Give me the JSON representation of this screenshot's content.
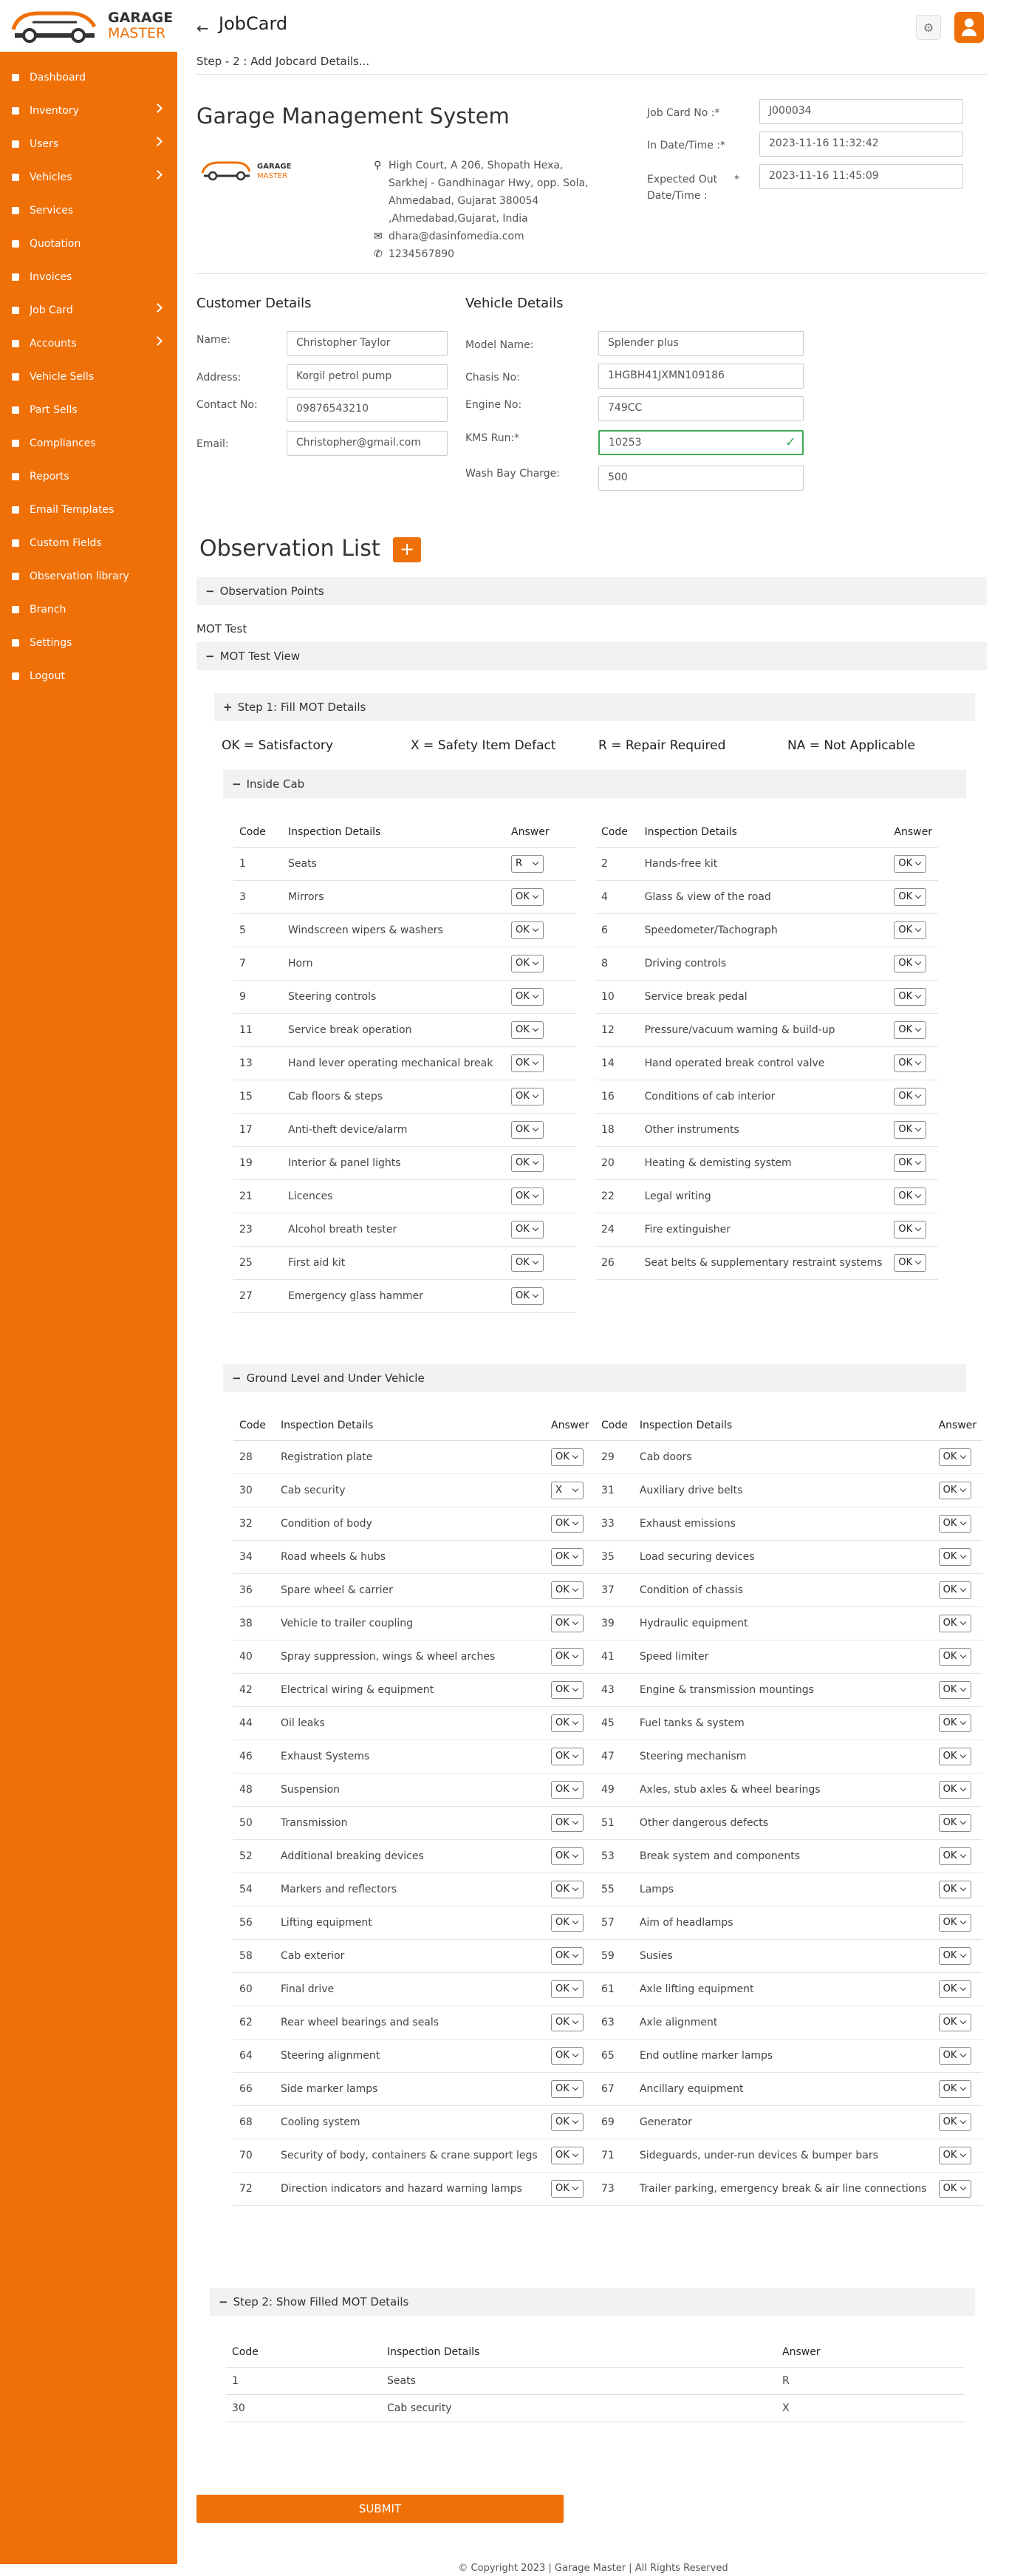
{
  "brand": {
    "line1": "GARAGE",
    "line2": "MASTER"
  },
  "sidebar": {
    "items": [
      {
        "label": "Dashboard",
        "icon": "home-icon",
        "arrow": false
      },
      {
        "label": "Inventory",
        "icon": "inventory-icon",
        "arrow": true
      },
      {
        "label": "Users",
        "icon": "user-icon",
        "arrow": true
      },
      {
        "label": "Vehicles",
        "icon": "car-icon",
        "arrow": true
      },
      {
        "label": "Services",
        "icon": "wrench-icon",
        "arrow": false
      },
      {
        "label": "Quotation",
        "icon": "document-icon",
        "arrow": false
      },
      {
        "label": "Invoices",
        "icon": "invoice-icon",
        "arrow": false
      },
      {
        "label": "Job Card",
        "icon": "jobcard-icon",
        "arrow": true
      },
      {
        "label": "Accounts",
        "icon": "accounts-icon",
        "arrow": true
      },
      {
        "label": "Vehicle Sells",
        "icon": "tag-icon",
        "arrow": false
      },
      {
        "label": "Part Sells",
        "icon": "tag-icon",
        "arrow": false
      },
      {
        "label": "Compliances",
        "icon": "compliance-icon",
        "arrow": false
      },
      {
        "label": "Reports",
        "icon": "reports-icon",
        "arrow": false
      },
      {
        "label": "Email Templates",
        "icon": "email-icon",
        "arrow": false
      },
      {
        "label": "Custom Fields",
        "icon": "puzzle-icon",
        "arrow": false
      },
      {
        "label": "Observation library",
        "icon": "library-icon",
        "arrow": false
      },
      {
        "label": "Branch",
        "icon": "branch-icon",
        "arrow": false
      },
      {
        "label": "Settings",
        "icon": "gear-icon",
        "arrow": false
      },
      {
        "label": "Logout",
        "icon": "power-icon",
        "arrow": false
      }
    ]
  },
  "header": {
    "title": "JobCard",
    "step": "Step - 2 : Add Jobcard Details..."
  },
  "company": {
    "title": "Garage Management System",
    "address": "High Court, A 206, Shopath Hexa, Sarkhej - Gandhinagar Hwy, opp. Sola, Ahmedabad, Gujarat 380054 ,Ahmedabad,Gujarat, India",
    "email": "dhara@dasinfomedia.com",
    "phone": "1234567890"
  },
  "job": {
    "jobcard_label": "Job Card No :*",
    "jobcard_value": "J000034",
    "indate_label": "In Date/Time :*",
    "indate_value": "2023-11-16 11:32:42",
    "outdate_label": "Expected Out Date/Time :",
    "outdate_star": "*",
    "outdate_value": "2023-11-16  11:45:09"
  },
  "customer": {
    "title": "Customer Details",
    "name_label": "Name:",
    "name": "Christopher Taylor",
    "address_label": "Address:",
    "address": "Korgil petrol pump",
    "contact_label": "Contact No:",
    "contact": "09876543210",
    "email_label": "Email:",
    "email": "Christopher@gmail.com"
  },
  "vehicle": {
    "title": "Vehicle Details",
    "model_label": "Model Name:",
    "model": "Splender plus",
    "chassis_label": "Chasis No:",
    "chassis": "1HGBH41JXMN109186",
    "engine_label": "Engine No:",
    "engine": "749CC",
    "kms_label": "KMS Run:*",
    "kms": "10253",
    "wash_label": "Wash Bay Charge:",
    "wash": "500"
  },
  "observation": {
    "title": "Observation List",
    "add": "+",
    "points": "Observation Points",
    "mot_test": "MOT Test",
    "mot_view": "MOT Test View",
    "step1": "Step 1: Fill MOT Details",
    "legend": [
      "OK = Satisfactory",
      "X = Safety Item Defact",
      "R = Repair Required",
      "NA = Not Applicable"
    ],
    "inside_cab": "Inside Cab",
    "ground": "Ground Level and Under Vehicle",
    "step2": "Step 2: Show Filled MOT Details",
    "col_code": "Code",
    "col_details": "Inspection Details",
    "col_answer": "Answer"
  },
  "inside_cab_rows": [
    {
      "code": "1",
      "details": "Seats",
      "answer": "R"
    },
    {
      "code": "2",
      "details": "Hands-free kit",
      "answer": "OK"
    },
    {
      "code": "3",
      "details": "Mirrors",
      "answer": "OK"
    },
    {
      "code": "4",
      "details": "Glass & view of the road",
      "answer": "OK"
    },
    {
      "code": "5",
      "details": "Windscreen wipers & washers",
      "answer": "OK"
    },
    {
      "code": "6",
      "details": "Speedometer/Tachograph",
      "answer": "OK"
    },
    {
      "code": "7",
      "details": "Horn",
      "answer": "OK"
    },
    {
      "code": "8",
      "details": "Driving controls",
      "answer": "OK"
    },
    {
      "code": "9",
      "details": "Steering controls",
      "answer": "OK"
    },
    {
      "code": "10",
      "details": "Service break pedal",
      "answer": "OK"
    },
    {
      "code": "11",
      "details": "Service break operation",
      "answer": "OK"
    },
    {
      "code": "12",
      "details": "Pressure/vacuum warning & build-up",
      "answer": "OK"
    },
    {
      "code": "13",
      "details": "Hand lever operating mechanical break",
      "answer": "OK"
    },
    {
      "code": "14",
      "details": "Hand operated break control valve",
      "answer": "OK"
    },
    {
      "code": "15",
      "details": "Cab floors & steps",
      "answer": "OK"
    },
    {
      "code": "16",
      "details": "Conditions of cab interior",
      "answer": "OK"
    },
    {
      "code": "17",
      "details": "Anti-theft device/alarm",
      "answer": "OK"
    },
    {
      "code": "18",
      "details": "Other instruments",
      "answer": "OK"
    },
    {
      "code": "19",
      "details": "Interior & panel lights",
      "answer": "OK"
    },
    {
      "code": "20",
      "details": "Heating & demisting system",
      "answer": "OK"
    },
    {
      "code": "21",
      "details": "Licences",
      "answer": "OK"
    },
    {
      "code": "22",
      "details": "Legal writing",
      "answer": "OK"
    },
    {
      "code": "23",
      "details": "Alcohol breath tester",
      "answer": "OK"
    },
    {
      "code": "24",
      "details": "Fire extinguisher",
      "answer": "OK"
    },
    {
      "code": "25",
      "details": "First aid kit",
      "answer": "OK"
    },
    {
      "code": "26",
      "details": "Seat belts & supplementary restraint systems",
      "answer": "OK"
    },
    {
      "code": "27",
      "details": "Emergency glass hammer",
      "answer": "OK"
    }
  ],
  "ground_rows": [
    {
      "code": "28",
      "details": "Registration plate",
      "answer": "OK"
    },
    {
      "code": "29",
      "details": "Cab doors",
      "answer": "OK"
    },
    {
      "code": "30",
      "details": "Cab security",
      "answer": "X"
    },
    {
      "code": "31",
      "details": "Auxiliary drive belts",
      "answer": "OK"
    },
    {
      "code": "32",
      "details": "Condition of body",
      "answer": "OK"
    },
    {
      "code": "33",
      "details": "Exhaust emissions",
      "answer": "OK"
    },
    {
      "code": "34",
      "details": "Road wheels & hubs",
      "answer": "OK"
    },
    {
      "code": "35",
      "details": "Load securing devices",
      "answer": "OK"
    },
    {
      "code": "36",
      "details": "Spare wheel & carrier",
      "answer": "OK"
    },
    {
      "code": "37",
      "details": "Condition of chassis",
      "answer": "OK"
    },
    {
      "code": "38",
      "details": "Vehicle to trailer coupling",
      "answer": "OK"
    },
    {
      "code": "39",
      "details": "Hydraulic equipment",
      "answer": "OK"
    },
    {
      "code": "40",
      "details": "Spray suppression, wings & wheel arches",
      "answer": "OK"
    },
    {
      "code": "41",
      "details": "Speed limiter",
      "answer": "OK"
    },
    {
      "code": "42",
      "details": "Electrical wiring & equipment",
      "answer": "OK"
    },
    {
      "code": "43",
      "details": "Engine & transmission mountings",
      "answer": "OK"
    },
    {
      "code": "44",
      "details": "Oil leaks",
      "answer": "OK"
    },
    {
      "code": "45",
      "details": "Fuel tanks & system",
      "answer": "OK"
    },
    {
      "code": "46",
      "details": "Exhaust Systems",
      "answer": "OK"
    },
    {
      "code": "47",
      "details": "Steering mechanism",
      "answer": "OK"
    },
    {
      "code": "48",
      "details": "Suspension",
      "answer": "OK"
    },
    {
      "code": "49",
      "details": "Axles, stub axles & wheel bearings",
      "answer": "OK"
    },
    {
      "code": "50",
      "details": "Transmission",
      "answer": "OK"
    },
    {
      "code": "51",
      "details": "Other dangerous defects",
      "answer": "OK"
    },
    {
      "code": "52",
      "details": "Additional breaking devices",
      "answer": "OK"
    },
    {
      "code": "53",
      "details": "Break system and components",
      "answer": "OK"
    },
    {
      "code": "54",
      "details": "Markers and reflectors",
      "answer": "OK"
    },
    {
      "code": "55",
      "details": "Lamps",
      "answer": "OK"
    },
    {
      "code": "56",
      "details": "Lifting equipment",
      "answer": "OK"
    },
    {
      "code": "57",
      "details": "Aim of headlamps",
      "answer": "OK"
    },
    {
      "code": "58",
      "details": "Cab exterior",
      "answer": "OK"
    },
    {
      "code": "59",
      "details": "Susies",
      "answer": "OK"
    },
    {
      "code": "60",
      "details": "Final drive",
      "answer": "OK"
    },
    {
      "code": "61",
      "details": "Axle lifting equipment",
      "answer": "OK"
    },
    {
      "code": "62",
      "details": "Rear wheel bearings and seals",
      "answer": "OK"
    },
    {
      "code": "63",
      "details": "Axle alignment",
      "answer": "OK"
    },
    {
      "code": "64",
      "details": "Steering alignment",
      "answer": "OK"
    },
    {
      "code": "65",
      "details": "End outline marker lamps",
      "answer": "OK"
    },
    {
      "code": "66",
      "details": "Side marker lamps",
      "answer": "OK"
    },
    {
      "code": "67",
      "details": "Ancillary equipment",
      "answer": "OK"
    },
    {
      "code": "68",
      "details": "Cooling system",
      "answer": "OK"
    },
    {
      "code": "69",
      "details": "Generator",
      "answer": "OK"
    },
    {
      "code": "70",
      "details": "Security of body, containers & crane support legs",
      "answer": "OK"
    },
    {
      "code": "71",
      "details": "Sideguards, under-run devices & bumper bars",
      "answer": "OK"
    },
    {
      "code": "72",
      "details": "Direction indicators and hazard warning lamps",
      "answer": "OK"
    },
    {
      "code": "73",
      "details": "Trailer parking, emergency break & air line connections",
      "answer": "OK"
    }
  ],
  "filled_rows": [
    {
      "code": "1",
      "details": "Seats",
      "answer": "R"
    },
    {
      "code": "30",
      "details": "Cab security",
      "answer": "X"
    }
  ],
  "submit": "SUBMIT",
  "footer": "© Copyright 2023 | Garage Master | All Rights Reserved",
  "colors": {
    "brand": "#f07008",
    "success": "#3caa55"
  }
}
